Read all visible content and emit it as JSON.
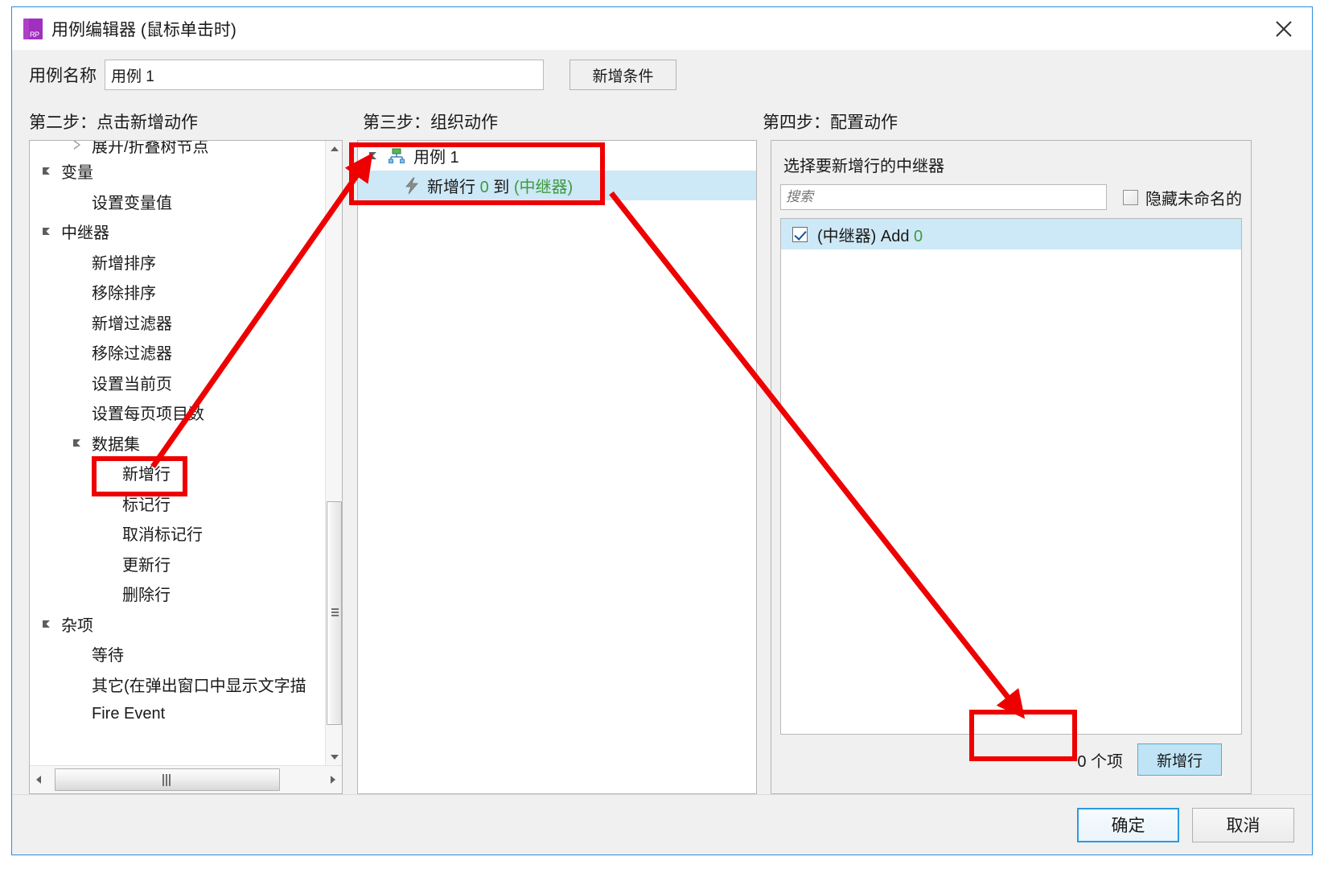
{
  "window": {
    "title": "用例编辑器 (鼠标单击时)",
    "app_icon_text": "RP",
    "close_icon": "close-icon"
  },
  "name_row": {
    "label": "用例名称",
    "value": "用例 1",
    "add_condition_button": "新增条件"
  },
  "steps": {
    "step2_title": "第二步：点击新增动作",
    "step3_title": "第三步：组织动作",
    "step4_title": "第四步：配置动作"
  },
  "action_tree": {
    "items": [
      {
        "label": "展开/折叠树节点",
        "indent": 1,
        "arrow": "collapsed",
        "clipped": true
      },
      {
        "label": "变量",
        "indent": 0,
        "arrow": "expanded"
      },
      {
        "label": "设置变量值",
        "indent": 1,
        "arrow": "none"
      },
      {
        "label": "中继器",
        "indent": 0,
        "arrow": "expanded"
      },
      {
        "label": "新增排序",
        "indent": 1,
        "arrow": "none"
      },
      {
        "label": "移除排序",
        "indent": 1,
        "arrow": "none"
      },
      {
        "label": "新增过滤器",
        "indent": 1,
        "arrow": "none"
      },
      {
        "label": "移除过滤器",
        "indent": 1,
        "arrow": "none"
      },
      {
        "label": "设置当前页",
        "indent": 1,
        "arrow": "none"
      },
      {
        "label": "设置每页项目数",
        "indent": 1,
        "arrow": "none"
      },
      {
        "label": "数据集",
        "indent": 1,
        "arrow": "expanded"
      },
      {
        "label": "新增行",
        "indent": 2,
        "arrow": "none",
        "highlighted": true
      },
      {
        "label": "标记行",
        "indent": 2,
        "arrow": "none"
      },
      {
        "label": "取消标记行",
        "indent": 2,
        "arrow": "none"
      },
      {
        "label": "更新行",
        "indent": 2,
        "arrow": "none"
      },
      {
        "label": "删除行",
        "indent": 2,
        "arrow": "none"
      },
      {
        "label": "杂项",
        "indent": 0,
        "arrow": "expanded"
      },
      {
        "label": "等待",
        "indent": 1,
        "arrow": "none"
      },
      {
        "label": "其它(在弹出窗口中显示文字描",
        "indent": 1,
        "arrow": "none"
      },
      {
        "label": "Fire Event",
        "indent": 1,
        "arrow": "none"
      }
    ]
  },
  "organize_tree": {
    "root": {
      "label": "用例 1",
      "icon": "case-icon",
      "arrow": "expanded"
    },
    "child": {
      "icon": "lightning-icon",
      "parts": [
        {
          "text": "新增行 ",
          "color": "black"
        },
        {
          "text": "0",
          "color": "green"
        },
        {
          "text": " 到 ",
          "color": "black"
        },
        {
          "text": "(中继器)",
          "color": "green"
        }
      ],
      "selected": true
    }
  },
  "configure": {
    "heading": "选择要新增行的中继器",
    "search_placeholder": "搜索",
    "search_value": "",
    "hide_unnamed_label": "隐藏未命名的",
    "hide_unnamed_checked": false,
    "list": [
      {
        "checked": true,
        "selected": true,
        "parts": [
          {
            "text": "(中继器) Add ",
            "color": "black"
          },
          {
            "text": "0",
            "color": "green"
          }
        ]
      }
    ],
    "count_text": "0 个项",
    "add_row_button": "新增行"
  },
  "footer": {
    "ok_label": "确定",
    "cancel_label": "取消"
  },
  "colors": {
    "accent_blue": "#2b9be0",
    "selection_blue": "#cde8f6",
    "annotation_red": "#ee0000",
    "green_value": "#3f9a3f",
    "app_icon_purple": "#a12fbf"
  }
}
